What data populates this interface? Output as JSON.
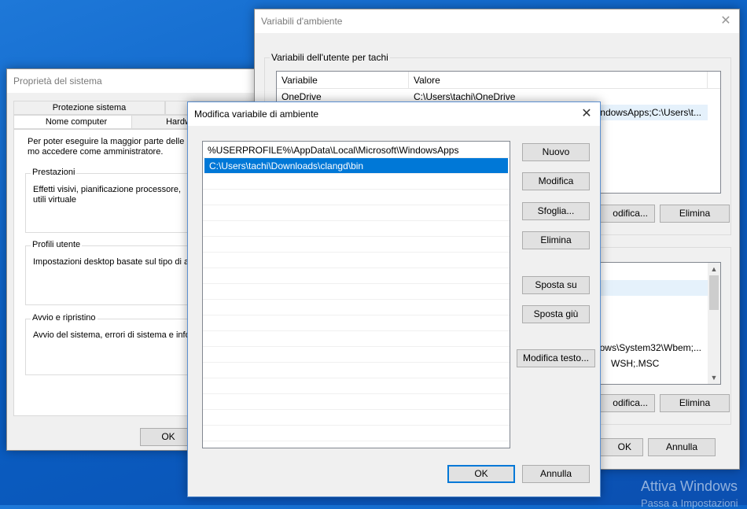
{
  "sysprops": {
    "title": "Proprietà del sistema",
    "tabs_row1": [
      "Protezione sistema",
      ""
    ],
    "tabs_row2": [
      "Nome computer",
      "Hardw"
    ],
    "intro": "Per poter eseguire la maggior parte delle mo accedere come amministratore.",
    "groups": [
      {
        "label": "Prestazioni",
        "text": "Effetti visivi, pianificazione processore, utili virtuale"
      },
      {
        "label": "Profili utente",
        "text": "Impostazioni desktop basate sul tipo di acc"
      },
      {
        "label": "Avvio e ripristino",
        "text": "Avvio del sistema, errori di sistema e inform"
      }
    ],
    "ok": "OK"
  },
  "envvars": {
    "title": "Variabili d'ambiente",
    "user_group_label": "Variabili dell'utente per tachi",
    "columns": [
      "Variabile",
      "Valore"
    ],
    "user_rows": [
      {
        "name": "OneDrive",
        "value": "C:\\Users\\tachi\\OneDrive"
      },
      {
        "name": "",
        "value": "ndowsApps;C:\\Users\\t..."
      }
    ],
    "user_edit": "odifica...",
    "user_delete": "Elimina",
    "sys_rows": [
      {
        "value": "ows\\System32\\Wbem;..."
      },
      {
        "value": "WSH;.MSC"
      }
    ],
    "sys_edit": "odifica...",
    "sys_delete": "Elimina",
    "ok": "OK",
    "cancel": "Annulla"
  },
  "editdlg": {
    "title": "Modifica variabile di ambiente",
    "items": [
      "%USERPROFILE%\\AppData\\Local\\Microsoft\\WindowsApps",
      "C:\\Users\\tachi\\Downloads\\clangd\\bin"
    ],
    "selected_index": 1,
    "buttons": {
      "new": "Nuovo",
      "edit": "Modifica",
      "browse": "Sfoglia...",
      "delete": "Elimina",
      "up": "Sposta su",
      "down": "Sposta giù",
      "edit_text": "Modifica testo..."
    },
    "ok": "OK",
    "cancel": "Annulla"
  },
  "watermark": {
    "line1": "Attiva Windows",
    "line2": "Passa a Impostazioni"
  },
  "colors": {
    "accent": "#0078d7",
    "desktop": "#0a5fc4"
  }
}
